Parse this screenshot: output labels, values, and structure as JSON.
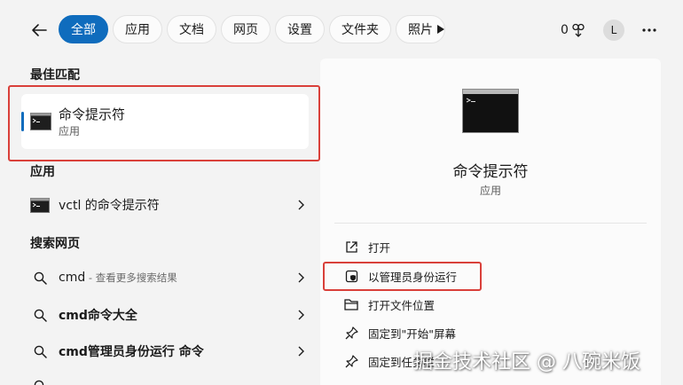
{
  "topbar": {
    "tabs": [
      {
        "label": "全部",
        "active": true
      },
      {
        "label": "应用",
        "active": false
      },
      {
        "label": "文档",
        "active": false
      },
      {
        "label": "网页",
        "active": false
      },
      {
        "label": "设置",
        "active": false
      },
      {
        "label": "文件夹",
        "active": false
      },
      {
        "label": "照片",
        "active": false
      }
    ],
    "points": "0",
    "avatar_initial": "L"
  },
  "left": {
    "best_match_header": "最佳匹配",
    "best_match": {
      "title": "命令提示符",
      "subtitle": "应用"
    },
    "apps_header": "应用",
    "apps": [
      {
        "label": "vctl 的命令提示符"
      }
    ],
    "web_header": "搜索网页",
    "web": [
      {
        "query": "cmd",
        "hint": " - 查看更多搜索结果"
      },
      {
        "query": "cmd命令大全",
        "hint": ""
      },
      {
        "query": "cmd管理员身份运行 命令",
        "hint": ""
      }
    ]
  },
  "panel": {
    "title": "命令提示符",
    "subtitle": "应用",
    "actions": [
      {
        "label": "打开",
        "icon": "open-icon"
      },
      {
        "label": "以管理员身份运行",
        "icon": "shield-icon"
      },
      {
        "label": "打开文件位置",
        "icon": "folder-icon"
      },
      {
        "label": "固定到\"开始\"屏幕",
        "icon": "pin-icon"
      },
      {
        "label": "固定到任务栏",
        "icon": "pin-icon"
      }
    ]
  },
  "watermark": "掘金技术社区 @ 八碗米饭",
  "colors": {
    "accent": "#0f6cbd",
    "highlight_box": "#d9403a"
  }
}
